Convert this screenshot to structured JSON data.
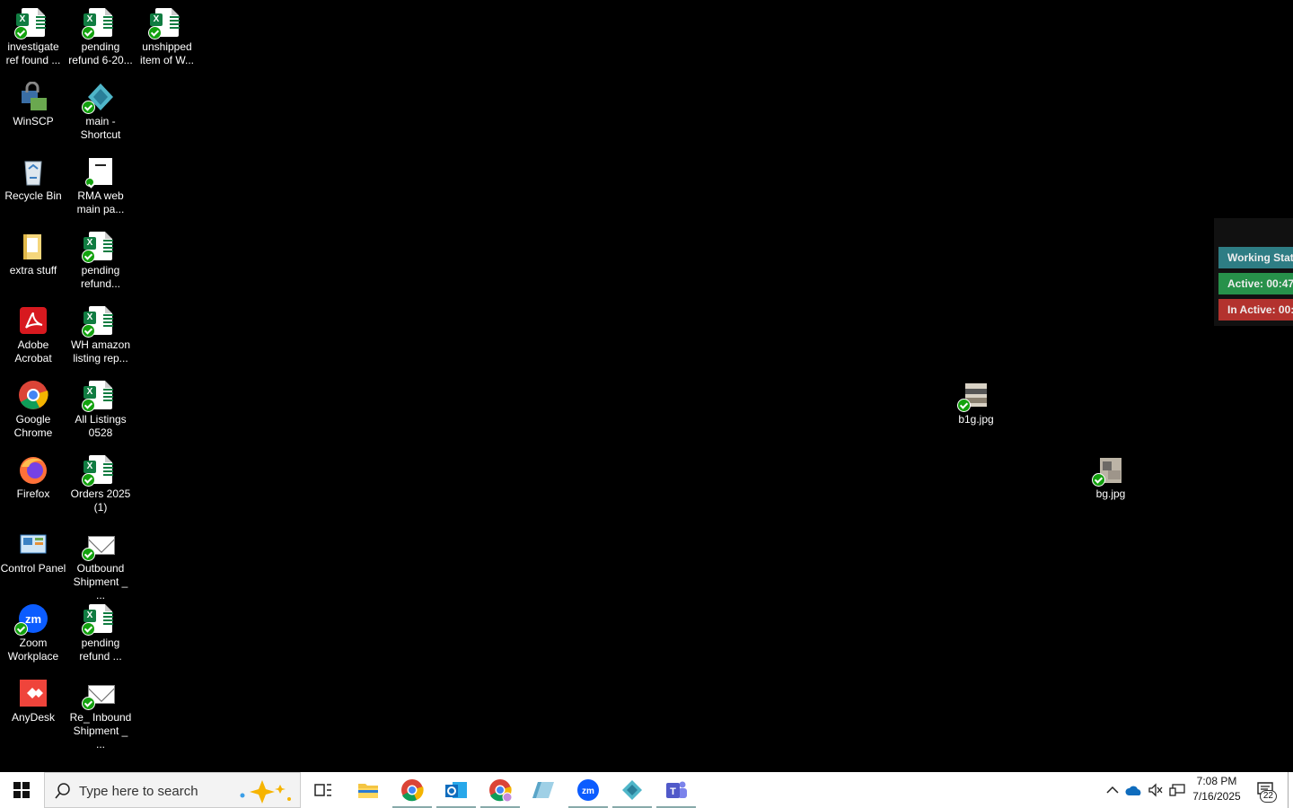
{
  "desktop": {
    "icons": [
      {
        "label": "investigate ref found ...",
        "type": "excel"
      },
      {
        "label": "pending refund 6-20...",
        "type": "excel"
      },
      {
        "label": "unshipped item of W...",
        "type": "excel"
      },
      {
        "label": "WinSCP",
        "type": "app"
      },
      {
        "label": "main - Shortcut",
        "type": "app"
      },
      {
        "label": "Recycle Bin",
        "type": "bin"
      },
      {
        "label": "RMA web main pa...",
        "type": "doc"
      },
      {
        "label": "extra stuff",
        "type": "folder"
      },
      {
        "label": "pending refund...",
        "type": "excel"
      },
      {
        "label": "Adobe Acrobat",
        "type": "app"
      },
      {
        "label": "WH amazon listing rep...",
        "type": "excel"
      },
      {
        "label": "Google Chrome",
        "type": "app"
      },
      {
        "label": "All Listings 0528",
        "type": "excel"
      },
      {
        "label": "Firefox",
        "type": "app"
      },
      {
        "label": "Orders 2025 (1)",
        "type": "excel"
      },
      {
        "label": "Control Panel",
        "type": "app"
      },
      {
        "label": "Outbound Shipment _ ...",
        "type": "mail"
      },
      {
        "label": "Zoom Workplace",
        "type": "app"
      },
      {
        "label": "pending refund ...",
        "type": "excel"
      },
      {
        "label": "AnyDesk",
        "type": "app"
      },
      {
        "label": "Re_ Inbound Shipment _ ...",
        "type": "mail"
      },
      {
        "label": "b1g.jpg",
        "type": "image"
      },
      {
        "label": "bg.jpg",
        "type": "image"
      }
    ]
  },
  "tracker": {
    "working": "Working Stat",
    "active": "Active: 00:47",
    "inactive": "In Active: 00:"
  },
  "taskbar": {
    "search_placeholder": "Type here to search",
    "apps": [
      "task-view",
      "file-explorer",
      "google-chrome",
      "outlook",
      "chrome-profile",
      "app-shortcut",
      "zoom",
      "main-app",
      "teams"
    ],
    "time": "7:08 PM",
    "date": "7/16/2025",
    "notifications": "22"
  },
  "colors": {
    "excel_green": "#107c41",
    "sync_check": "#13a10e",
    "working": "#2e7d84",
    "active": "#27914a",
    "inactive": "#b3322e"
  }
}
